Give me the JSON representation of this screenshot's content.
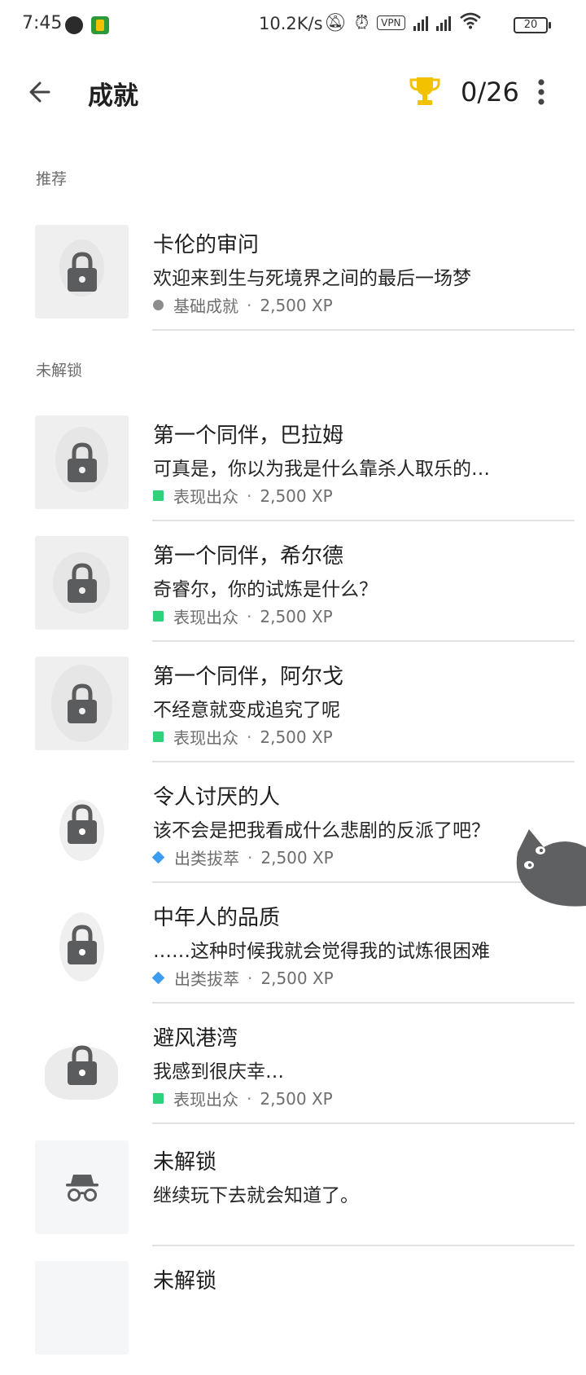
{
  "status_bar": {
    "time": "7:45",
    "net_speed": "10.2K/s",
    "vpn_label": "VPN",
    "battery": "20"
  },
  "app_bar": {
    "title": "成就",
    "progress_count": "0/26",
    "trophy_color": "#f2c200"
  },
  "sections": {
    "recommended_label": "推荐",
    "locked_label": "未解锁"
  },
  "achievements": [
    {
      "title": "卡伦的审问",
      "desc": "欢迎来到生与死境界之间的最后一场梦",
      "tier": "基础成就",
      "tier_mark": "grey",
      "xp": "2,500 XP"
    },
    {
      "title": "第一个同伴，巴拉姆",
      "desc": "可真是，你以为我是什么靠杀人取乐的…",
      "tier": "表现出众",
      "tier_mark": "green",
      "xp": "2,500 XP"
    },
    {
      "title": "第一个同伴，希尔德",
      "desc": "奇睿尔，你的试炼是什么？",
      "tier": "表现出众",
      "tier_mark": "green",
      "xp": "2,500 XP"
    },
    {
      "title": "第一个同伴，阿尔戈",
      "desc": "不经意就变成追究了呢",
      "tier": "表现出众",
      "tier_mark": "green",
      "xp": "2,500 XP"
    },
    {
      "title": "令人讨厌的人",
      "desc": "该不会是把我看成什么悲剧的反派了吧？",
      "tier": "出类拔萃",
      "tier_mark": "blue",
      "xp": "2,500 XP"
    },
    {
      "title": "中年人的品质",
      "desc": "……这种时候我就会觉得我的试炼很困难",
      "tier": "出类拔萃",
      "tier_mark": "blue",
      "xp": "2,500 XP"
    },
    {
      "title": "避风港湾",
      "desc": "我感到很庆幸…",
      "tier": "表现出众",
      "tier_mark": "green",
      "xp": "2,500 XP"
    },
    {
      "title": "未解锁",
      "desc": "继续玩下去就会知道了。"
    },
    {
      "title": "未解锁"
    }
  ],
  "colors": {
    "basic_tier": "#8c8c8c",
    "outstanding_tier": "#2fd27a",
    "excellent_tier": "#3b9cf0"
  }
}
